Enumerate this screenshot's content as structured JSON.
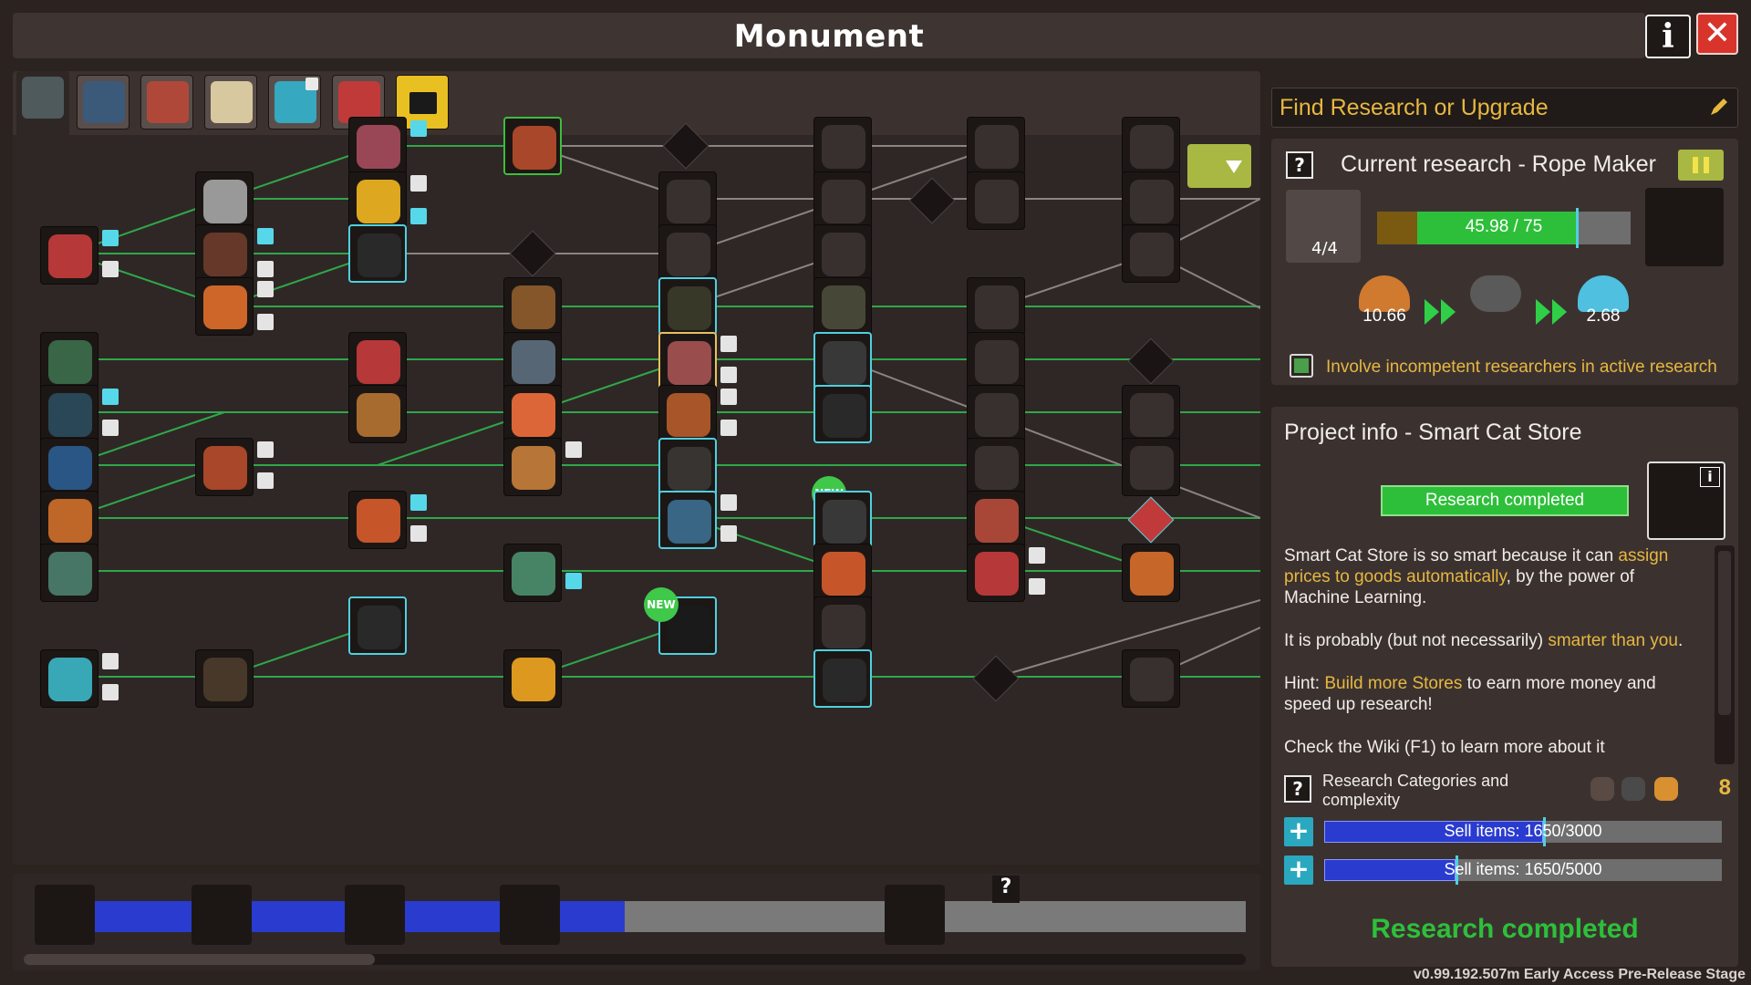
{
  "window": {
    "title": "Monument",
    "info_icon": "info-icon",
    "close_icon": "close-icon"
  },
  "tabs": [
    {
      "name": "tab-monument",
      "active": true,
      "color": "#4e5a5c"
    },
    {
      "name": "tab-arcade",
      "active": false,
      "color": "#3b5a7a"
    },
    {
      "name": "tab-tavern",
      "active": false,
      "color": "#b0483a"
    },
    {
      "name": "tab-food",
      "active": false,
      "color": "#d8c8a0"
    },
    {
      "name": "tab-tech",
      "active": false,
      "color": "#36a8c0",
      "locked": true
    },
    {
      "name": "tab-rocket",
      "active": false,
      "color": "#c03a3a"
    },
    {
      "name": "tab-video",
      "active": false,
      "color": "#1a1a1a",
      "yellow": true
    }
  ],
  "search": {
    "placeholder": "Find Research or Upgrade",
    "icon": "pencil-icon"
  },
  "current_research": {
    "title": "Current research - Rope Maker",
    "help_label": "?",
    "count": "4/4",
    "progress_text": "45.98 / 75",
    "progress_value": 45.98,
    "progress_max": 75,
    "input_value": "10.66",
    "output_value": "2.68",
    "involve_label": "Involve incompetent researchers in active research",
    "involve_checked": true
  },
  "project": {
    "title": "Project info - Smart Cat Store",
    "status": "Research completed",
    "info_label": "i",
    "desc_p1_a": "Smart Cat Store is so smart because it can ",
    "desc_p1_hl": "assign prices to goods automatically",
    "desc_p1_b": ", by the power of Machine Learning.",
    "desc_p2_a": "It is probably (but not necessarily) ",
    "desc_p2_hl": "smarter than you",
    "desc_p2_b": ".",
    "desc_p3_a": "Hint: ",
    "desc_p3_hl": "Build more Stores",
    "desc_p3_b": " to earn more money and speed up research!",
    "desc_p4": "Check the Wiki (F1) to learn more about it",
    "categories_label": "Research Categories and complexity",
    "categories_count": "8",
    "requirements": [
      {
        "text": "Sell items: 1650/3000",
        "value": 1650,
        "max": 3000
      },
      {
        "text": "Sell items: 1650/5000",
        "value": 1650,
        "max": 5000
      }
    ],
    "completed_label": "Research completed"
  },
  "timeline": {
    "progress_fraction": 0.46,
    "unknown_label": "?"
  },
  "badges": {
    "new": "NEW"
  },
  "version": "v0.99.192.507m Early Access Pre-Release Stage",
  "colors": {
    "accent_green": "#2ebf3a",
    "accent_yellow": "#e7b740",
    "accent_cyan": "#4fd0e0",
    "bar_blue": "#2a3bd0",
    "close_red": "#d8342c"
  }
}
